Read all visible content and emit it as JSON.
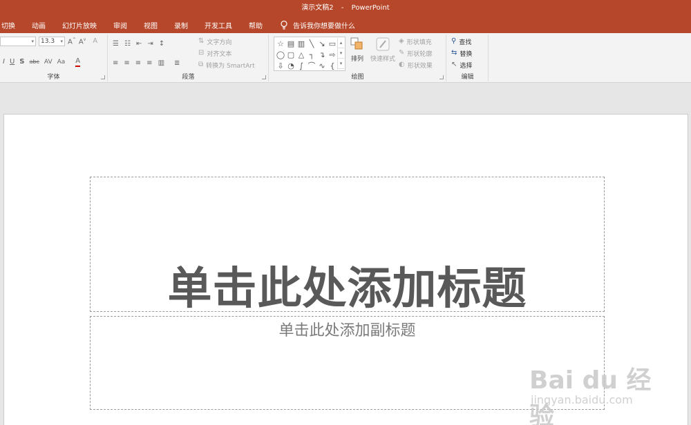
{
  "window": {
    "document_name": "演示文稿2",
    "separator": "-",
    "app_name": "PowerPoint"
  },
  "tabs": [
    "切换",
    "动画",
    "幻灯片放映",
    "审阅",
    "视图",
    "录制",
    "开发工具",
    "帮助"
  ],
  "tell_me": "告诉我你想要做什么",
  "ribbon": {
    "font": {
      "label": "字体",
      "size_value": "13.3",
      "grow_icon": "A",
      "shrink_icon": "A",
      "clear_icon": "A",
      "italic": "I",
      "underline": "U",
      "shadow": "S",
      "strike": "abc",
      "spacing": "AV",
      "case": "Aa",
      "color": "A"
    },
    "paragraph": {
      "label": "段落",
      "text_direction": "文字方向",
      "align_text": "对齐文本",
      "convert_smartart": "转换为 SmartArt"
    },
    "drawing": {
      "label": "绘图",
      "arrange": "排列",
      "quick_styles": "快速样式",
      "shape_fill": "形状填充",
      "shape_outline": "形状轮廓",
      "shape_effects": "形状效果"
    },
    "editing": {
      "label": "编辑",
      "find": "查找",
      "replace": "替换",
      "select": "选择"
    }
  },
  "slide": {
    "title_placeholder": "单击此处添加标题",
    "subtitle_placeholder": "单击此处添加副标题"
  },
  "watermark": {
    "main": "Bai du 经验",
    "sub": "jingyan.baidu.com"
  },
  "colors": {
    "accent": "#b7472a",
    "ribbon_bg": "#f3f3f3",
    "canvas_bg": "#e6e6e6"
  }
}
